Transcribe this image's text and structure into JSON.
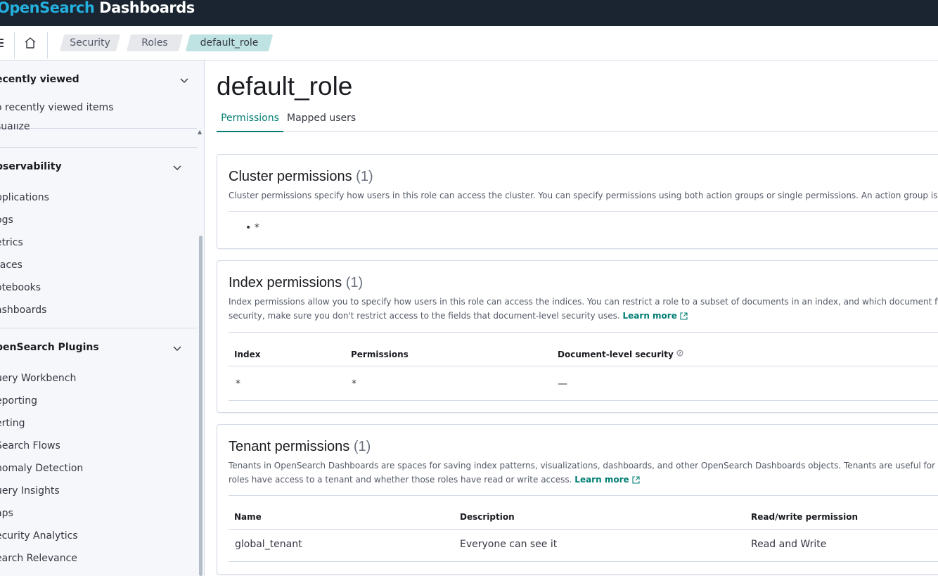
{
  "header": {
    "brand_part1": "OpenSearch",
    "brand_part2": " Dashboards"
  },
  "breadcrumbs": [
    "Security",
    "Roles",
    "default_role"
  ],
  "sidebar": {
    "recently_viewed": {
      "title": "ecently viewed",
      "empty_text": "o recently viewed items",
      "cut_item": "sualize"
    },
    "observability": {
      "title": "bservability",
      "items": [
        "pplications",
        "ogs",
        "etrics",
        "races",
        "otebooks",
        "ashboards"
      ]
    },
    "plugins": {
      "title": "penSearch Plugins",
      "items": [
        "uery Workbench",
        "eporting",
        "erting",
        " Search Flows",
        "nomaly Detection",
        "uery Insights",
        "aps",
        "ecurity Analytics",
        "earch Relevance"
      ]
    }
  },
  "page": {
    "title": "default_role",
    "tabs": [
      "Permissions",
      "Mapped users"
    ]
  },
  "cluster": {
    "title": "Cluster permissions",
    "count": "(1)",
    "desc": "Cluster permissions specify how users in this role can access the cluster. You can specify permissions using both action groups or single permissions. An action group is a list of single",
    "items": [
      "*"
    ]
  },
  "index": {
    "title": "Index permissions",
    "count": "(1)",
    "desc1": "Index permissions allow you to specify how users in this role can access the indices. You can restrict a role to a subset of documents in an index, and which document fields a user can",
    "desc2": "security, make sure you don't restrict access to the fields that document-level security uses.",
    "learn_more": "Learn more",
    "columns": [
      "Index",
      "Permissions",
      "Document-level security"
    ],
    "rows": [
      [
        "*",
        "*",
        "—"
      ]
    ]
  },
  "tenant": {
    "title": "Tenant permissions",
    "count": "(1)",
    "desc1": "Tenants in OpenSearch Dashboards are spaces for saving index patterns, visualizations, dashboards, and other OpenSearch Dashboards objects. Tenants are useful for safely sharing",
    "desc2": "roles have access to a tenant and whether those roles have read or write access.",
    "learn_more": "Learn more",
    "columns": [
      "Name",
      "Description",
      "Read/write permission"
    ],
    "rows": [
      [
        "global_tenant",
        "Everyone can see it",
        "Read and Write"
      ]
    ]
  },
  "colors": {
    "header_bg": "#1a2531",
    "accent": "#017d73",
    "brand_blue": "#24b1e0"
  }
}
